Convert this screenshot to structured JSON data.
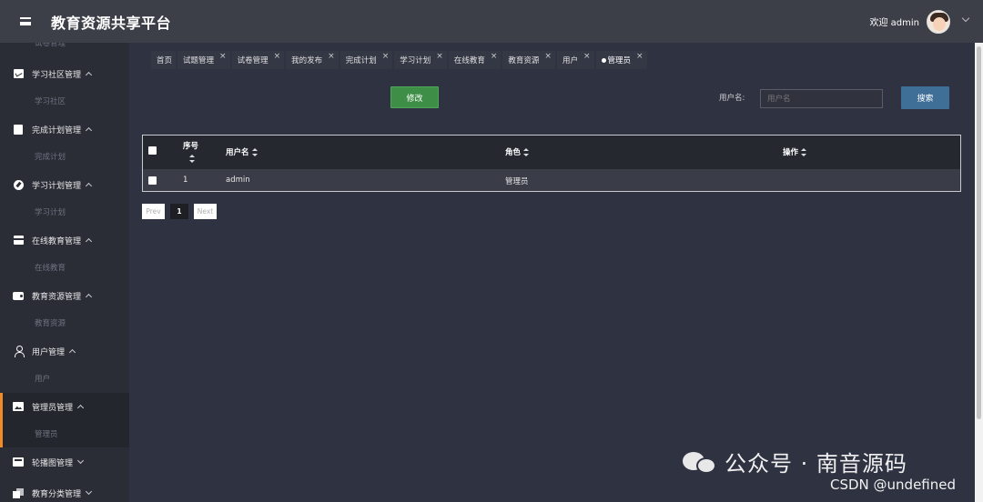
{
  "app": {
    "title": "教育资源共享平台"
  },
  "user": {
    "welcome": "欢迎 admin"
  },
  "sidebar": {
    "partial_top_label": "试卷管理",
    "groups": [
      {
        "label": "学习社区管理",
        "sub": "学习社区",
        "icon": "chart-icon"
      },
      {
        "label": "完成计划管理",
        "sub": "完成计划",
        "icon": "book-icon"
      },
      {
        "label": "学习计划管理",
        "sub": "学习计划",
        "icon": "compass-icon"
      },
      {
        "label": "在线教育管理",
        "sub": "在线教育",
        "icon": "gift-icon"
      },
      {
        "label": "教育资源管理",
        "sub": "教育资源",
        "icon": "wallet-icon"
      },
      {
        "label": "用户管理",
        "sub": "用户",
        "icon": "user-icon"
      },
      {
        "label": "管理员管理",
        "sub": "管理员",
        "icon": "image-icon",
        "active": true
      },
      {
        "label": "轮播图管理",
        "icon": "carousel-icon"
      },
      {
        "label": "教育分类管理",
        "icon": "copy-icon"
      }
    ],
    "accent_color": "#f08b2a"
  },
  "tabs": [
    {
      "label": "首页"
    },
    {
      "label": "试题管理",
      "close": "×"
    },
    {
      "label": "试卷管理",
      "close": "×"
    },
    {
      "label": "我的发布",
      "close": "×"
    },
    {
      "label": "完成计划",
      "close": "×"
    },
    {
      "label": "学习计划",
      "close": "×"
    },
    {
      "label": "在线教育",
      "close": "×"
    },
    {
      "label": "教育资源",
      "close": "×"
    },
    {
      "label": "用户",
      "close": "×"
    },
    {
      "label": "管理员",
      "close": "×",
      "current": true
    }
  ],
  "toolbar": {
    "edit_label": "修改",
    "search_label": "用户名:",
    "search_placeholder": "用户名",
    "search_button": "搜索",
    "edit_color": "#3e8e47",
    "search_color": "#3f6e97"
  },
  "table": {
    "columns": [
      "序号",
      "用户名",
      "角色",
      "操作"
    ],
    "rows": [
      {
        "index": "1",
        "username": "admin",
        "role": "管理员",
        "action": ""
      }
    ]
  },
  "pagination": {
    "prev": "Prev",
    "current": "1",
    "next": "Next"
  },
  "watermark": {
    "text": "公众号 · 南音源码",
    "csdn": "CSDN @undefined"
  }
}
